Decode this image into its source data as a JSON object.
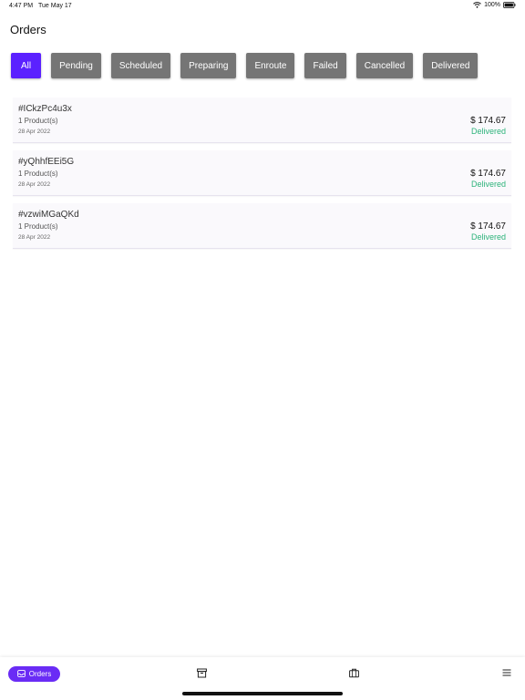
{
  "status_bar": {
    "time": "4:47 PM",
    "date": "Tue May 17",
    "battery": "100%"
  },
  "page": {
    "title": "Orders"
  },
  "filters": [
    {
      "label": "All",
      "active": true
    },
    {
      "label": "Pending",
      "active": false
    },
    {
      "label": "Scheduled",
      "active": false
    },
    {
      "label": "Preparing",
      "active": false
    },
    {
      "label": "Enroute",
      "active": false
    },
    {
      "label": "Failed",
      "active": false
    },
    {
      "label": "Cancelled",
      "active": false
    },
    {
      "label": "Delivered",
      "active": false
    }
  ],
  "orders": [
    {
      "id": "#ICkzPc4u3x",
      "products": "1 Product(s)",
      "date": "28 Apr 2022",
      "price": "$ 174.67",
      "status": "Delivered"
    },
    {
      "id": "#yQhhfEEi5G",
      "products": "1 Product(s)",
      "date": "28 Apr 2022",
      "price": "$ 174.67",
      "status": "Delivered"
    },
    {
      "id": "#vzwiMGaQKd",
      "products": "1 Product(s)",
      "date": "28 Apr 2022",
      "price": "$ 174.67",
      "status": "Delivered"
    }
  ],
  "bottom_nav": {
    "orders_label": "Orders",
    "icons": [
      "inbox-icon",
      "archive-icon",
      "briefcase-icon",
      "menu-icon"
    ]
  },
  "colors": {
    "accent": "#5b21ff",
    "nav_accent": "#6a2cf5",
    "chip_inactive": "#757575",
    "status_delivered": "#2db37a"
  }
}
